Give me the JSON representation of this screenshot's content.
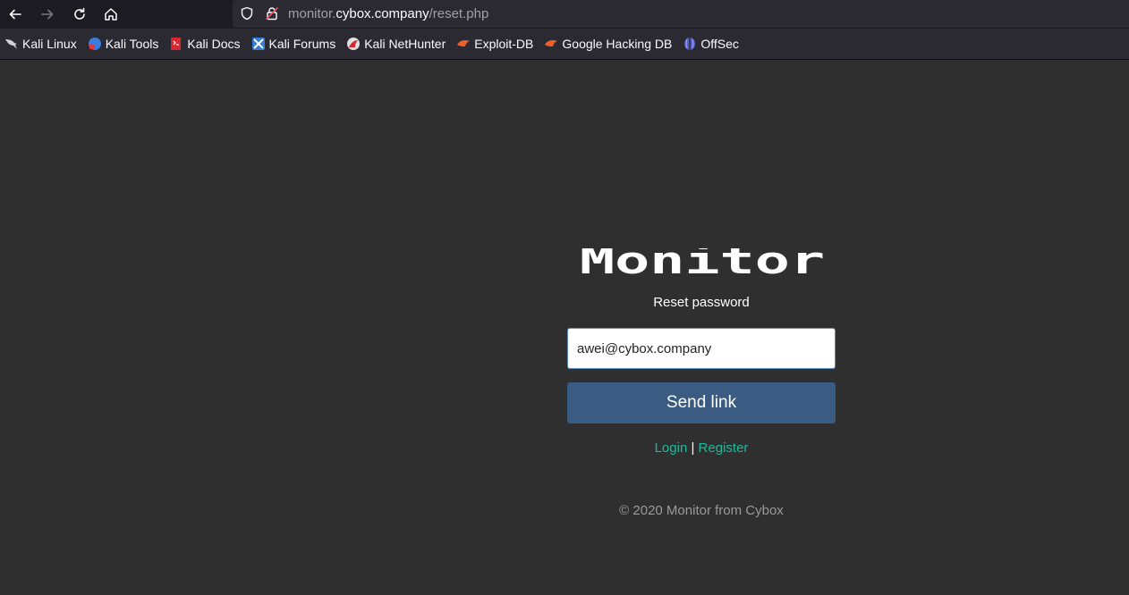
{
  "browser": {
    "url_prefix": "monitor.",
    "url_host": "cybox.company",
    "url_path": "/reset.php"
  },
  "bookmarks": [
    {
      "label": "Kali Linux",
      "icon": "kali-dragon-icon"
    },
    {
      "label": "Kali Tools",
      "icon": "kali-tools-icon"
    },
    {
      "label": "Kali Docs",
      "icon": "kali-docs-icon"
    },
    {
      "label": "Kali Forums",
      "icon": "kali-forums-icon"
    },
    {
      "label": "Kali NetHunter",
      "icon": "nethunter-icon"
    },
    {
      "label": "Exploit-DB",
      "icon": "exploit-db-icon"
    },
    {
      "label": "Google Hacking DB",
      "icon": "ghdb-icon"
    },
    {
      "label": "OffSec",
      "icon": "offsec-icon"
    }
  ],
  "page": {
    "logo_text": "Monitor",
    "subtitle": "Reset password",
    "email_value": "awei@cybox.company",
    "send_label": "Send link",
    "login_label": "Login",
    "separator": "|",
    "register_label": "Register",
    "footer": "© 2020 Monitor from Cybox"
  },
  "colors": {
    "background": "#2f2f2f",
    "button": "#3a5b82",
    "link": "#1abc9c"
  }
}
